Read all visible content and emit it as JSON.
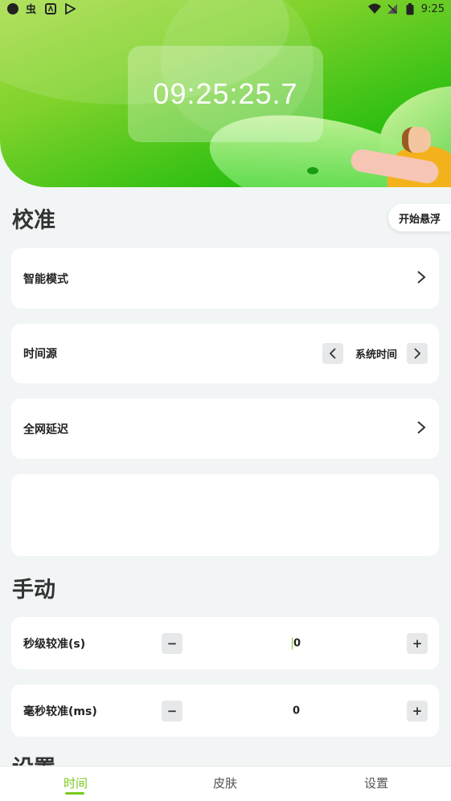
{
  "status_bar": {
    "time": "9:25",
    "left_icons": [
      "circle-icon",
      "bug-icon",
      "a-square-icon",
      "play-store-icon"
    ],
    "right_icons": [
      "wifi-icon",
      "no-signal-icon",
      "battery-icon"
    ]
  },
  "hero": {
    "clock": "09:25:25.7"
  },
  "calibration": {
    "title": "校准",
    "float_button": "开始悬浮",
    "smart_mode": {
      "label": "智能模式"
    },
    "time_source": {
      "label": "时间源",
      "value": "系统时间"
    },
    "network_delay": {
      "label": "全网延迟"
    }
  },
  "manual": {
    "title": "手动",
    "seconds": {
      "label": "秒级较准(s)",
      "value": "0",
      "minus": "−",
      "plus": "+"
    },
    "millis": {
      "label": "毫秒较准(ms)",
      "value": "0",
      "minus": "−",
      "plus": "+"
    }
  },
  "settings_peek": {
    "title": "设置"
  },
  "bottom_nav": {
    "items": [
      {
        "label": "时间",
        "active": true
      },
      {
        "label": "皮肤",
        "active": false
      },
      {
        "label": "设置",
        "active": false
      }
    ],
    "accent": "#7ac91f"
  },
  "colors": {
    "hero_green": "#2fbf12",
    "background": "#f2f5f6"
  }
}
